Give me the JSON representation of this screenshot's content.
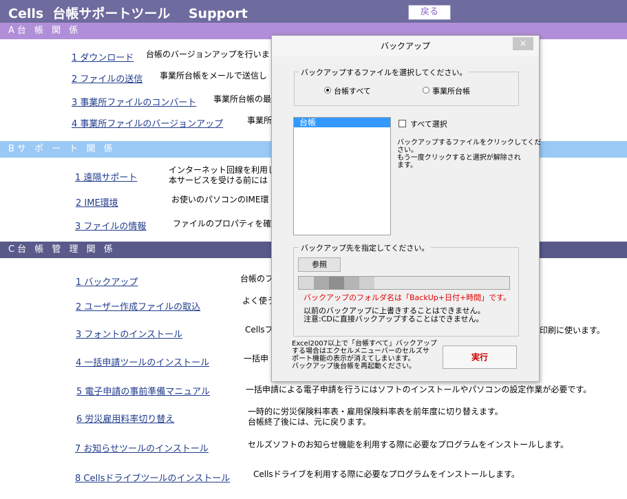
{
  "header": {
    "title": "Cells  台帳サポートツール    Support",
    "back_label": "戻る"
  },
  "sections": {
    "a": "A台 帳 関 係",
    "b": "Bサ ポ ー ト 関 係",
    "c": "C台 帳 管 理 関 係"
  },
  "a_items": [
    {
      "link": "1 ダウンロード",
      "desc": "台帳のバージョンアップを行いま"
    },
    {
      "link": "2 ファイルの送信",
      "desc": "事業所台帳をメールで送信し"
    },
    {
      "link": "3 事業所ファイルのコンバート",
      "desc": "事業所台帳の最"
    },
    {
      "link": "4 事業所ファイルのバージョンアップ",
      "desc": "事業所"
    }
  ],
  "b_items": [
    {
      "link": "1 遠隔サポート",
      "desc": "インターネット回線を利用し\n本サービスを受ける前には"
    },
    {
      "link": "2 IME環境",
      "desc": "お使いのパソコンのIME環"
    },
    {
      "link": "3 ファイルの情報",
      "desc": "ファイルのプロパティを確認"
    }
  ],
  "c_items": [
    {
      "link": "1 バックアップ",
      "desc": "台帳のフ"
    },
    {
      "link": "2 ユーザー作成ファイルの取込",
      "desc": "よく使う"
    },
    {
      "link": "3 フォントのインストール",
      "desc": "Cellsフ",
      "desc2": "印刷に使います。"
    },
    {
      "link": "4 一括申請ツールのインストール",
      "desc": "一括申"
    },
    {
      "link": "5 電子申請の事前準備マニュアル",
      "desc": "一括申請による電子申請を行うにはソフトのインストールやパソコンの設定作業が必要です。"
    },
    {
      "link": "6 労災雇用料率切り替え",
      "desc": "一時的に労災保険料率表・雇用保険料率表を前年度に切り替えます。\n台帳終了後には、元に戻ります。"
    },
    {
      "link": "7 お知らせツールのインストール",
      "desc": "セルズソフトのお知らせ機能を利用する際に必要なプログラムをインストールします。"
    },
    {
      "link": "8 Cellsドライブツールのインストール",
      "desc": "Cellsドライブを利用する際に必要なプログラムをインストールします。"
    }
  ],
  "dialog": {
    "title": "バックアップ",
    "close": "×",
    "select_group_label": "バックアップするファイルを選択してください。",
    "radio_all": "台帳すべて",
    "radio_office": "事業所台帳",
    "radio_selected": "all",
    "list_items": [
      "台帳"
    ],
    "select_all_label": "すべて選択",
    "select_all_checked": false,
    "instructions": "バックアップするファイルをクリックしてくだ\nさい。\nもう一度クリックすると選択が解除され\nます。",
    "dest_group_label": "バックアップ先を指定してください。",
    "browse_label": "参照",
    "folder_note": "バックアップのフォルダ名は「BackUp+日付+時間」です。",
    "overwrite_note": "以前のバックアップに上書きすることはできません。\n注意:CDに直接バックアップすることはできません。",
    "excel_note": "Excel2007以上で「台帳すべて」バックアップ\nする場合はエクセルメニューバーのセルズサ\nポート機能の表示が消えてしまいます。\nバックアップ後台帳を再起動ください。",
    "run_label": "実行"
  },
  "colors": {
    "titlebar": "#6e6b9f",
    "band_a": "#b18fd8",
    "band_b": "#9ac9f5",
    "band_c": "#595a8a",
    "link": "#1f3b8c",
    "run": "#cc0000"
  }
}
